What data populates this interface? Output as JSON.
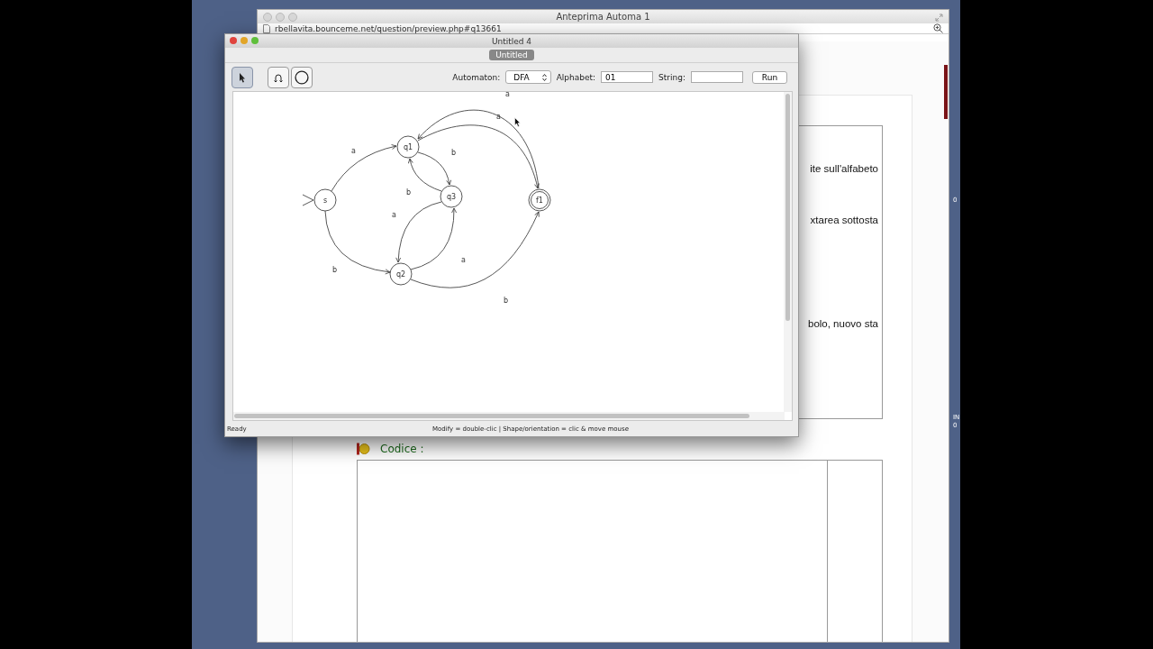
{
  "desktop_labels": [
    "0",
    "IN",
    "0"
  ],
  "browser": {
    "title": "Anteprima Automa 1",
    "url": "rbellavita.bounceme.net/question/preview.php#q13661",
    "fragments": [
      "ite sull'alfabeto",
      "xtarea sottosta",
      "bolo, nuovo sta"
    ],
    "code_label": "Codice :"
  },
  "app": {
    "title": "Untitled 4",
    "tabs": [
      {
        "label": "Untitled",
        "selected": true
      }
    ],
    "tools": [
      {
        "kind": "pointer",
        "selected": true
      },
      {
        "kind": "loop",
        "selected": false
      },
      {
        "kind": "state",
        "selected": false
      }
    ],
    "automaton_label": "Automaton:",
    "automaton_value": "DFA",
    "alphabet_label": "Alphabet:",
    "alphabet_value": "01",
    "string_label": "String:",
    "run": "Run",
    "states": [
      {
        "label": "s",
        "initial": true,
        "final": false
      },
      {
        "label": "q1",
        "initial": false,
        "final": false
      },
      {
        "label": "q3",
        "initial": false,
        "final": false
      },
      {
        "label": "q2",
        "initial": false,
        "final": false
      },
      {
        "label": "f1",
        "initial": false,
        "final": true
      }
    ],
    "transitions": [
      {
        "label": "a"
      },
      {
        "label": "b"
      },
      {
        "label": "b"
      },
      {
        "label": "b"
      },
      {
        "label": "a"
      },
      {
        "label": "a"
      },
      {
        "label": "b"
      },
      {
        "label": "a"
      },
      {
        "label": "a"
      }
    ],
    "status": "Ready",
    "hint": "Modify = double-clic | Shape/orientation = clic & move mouse"
  }
}
